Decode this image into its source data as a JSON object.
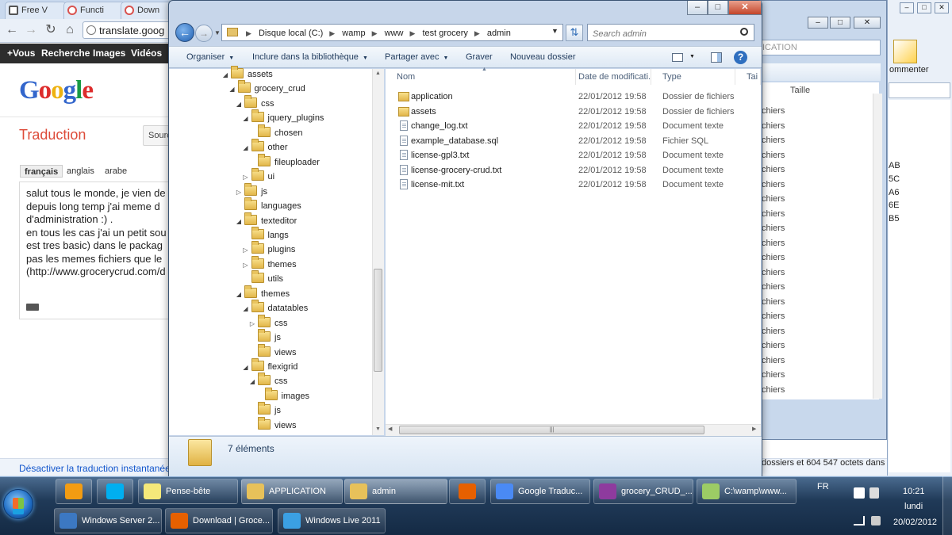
{
  "chrome": {
    "tabs": [
      "Free V",
      "Functi",
      "Down"
    ],
    "address": "translate.goog",
    "gbar": [
      "+Vous",
      "Recherche",
      "Images",
      "Vidéos"
    ],
    "logo": "Google",
    "title": "Traduction",
    "source_button": "Sourc",
    "lang_tabs": [
      "français",
      "anglais",
      "arabe"
    ],
    "source_lines": [
      "salut tous le monde, je vien de",
      "depuis long temp j'ai meme d",
      "d'administration :) .",
      "en tous les cas j'ai un petit sou",
      "est tres basic) dans le packag",
      "pas les memes fichiers que le",
      "(http://www.grocerycrud.com/d"
    ],
    "instant_link": "Désactiver la traduction instantanée"
  },
  "explorer2": {
    "header_size": "Taille",
    "search_hint": "ICATION",
    "row_label": "chiers",
    "row_value_top": "32",
    "status": "dossiers et 604 547 octets dans 5 fichiers"
  },
  "right_window": {
    "commenter": "ommenter",
    "hex_values": [
      "AB",
      "5C",
      "A6",
      "6E",
      "B5"
    ]
  },
  "explorer": {
    "title_buttons": {
      "minimize": "–",
      "maximize": "□",
      "close": "✕"
    },
    "breadcrumb": [
      "Disque local (C:)",
      "wamp",
      "www",
      "test grocery",
      "admin"
    ],
    "search_placeholder": "Search admin",
    "toolbar": {
      "organize": "Organiser",
      "include_library": "Inclure dans la bibliothèque",
      "share": "Partager avec",
      "burn": "Graver",
      "new_folder": "Nouveau dossier"
    },
    "tree": [
      {
        "label": "assets",
        "expanded": true
      },
      {
        "label": "grocery_crud",
        "expanded": true
      },
      {
        "label": "css",
        "expanded": true
      },
      {
        "label": "jquery_plugins",
        "expanded": true
      },
      {
        "label": "chosen",
        "expanded": null
      },
      {
        "label": "other",
        "expanded": true
      },
      {
        "label": "fileuploader",
        "expanded": null
      },
      {
        "label": "ui",
        "expanded": false
      },
      {
        "label": "js",
        "expanded": false
      },
      {
        "label": "languages",
        "expanded": null
      },
      {
        "label": "texteditor",
        "expanded": true
      },
      {
        "label": "langs",
        "expanded": null
      },
      {
        "label": "plugins",
        "expanded": false
      },
      {
        "label": "themes",
        "expanded": false
      },
      {
        "label": "utils",
        "expanded": null
      },
      {
        "label": "themes",
        "expanded": true
      },
      {
        "label": "datatables",
        "expanded": true
      },
      {
        "label": "css",
        "expanded": false
      },
      {
        "label": "js",
        "expanded": null
      },
      {
        "label": "views",
        "expanded": null
      },
      {
        "label": "flexigrid",
        "expanded": true
      },
      {
        "label": "css",
        "expanded": true
      },
      {
        "label": "images",
        "expanded": null
      },
      {
        "label": "js",
        "expanded": null
      },
      {
        "label": "views",
        "expanded": null
      }
    ],
    "columns": {
      "name": "Nom",
      "date": "Date de modificati...",
      "type": "Type",
      "size": "Tai"
    },
    "files": [
      {
        "name": "application",
        "date": "22/01/2012 19:58",
        "type": "Dossier de fichiers",
        "kind": "folder"
      },
      {
        "name": "assets",
        "date": "22/01/2012 19:58",
        "type": "Dossier de fichiers",
        "kind": "folder"
      },
      {
        "name": "change_log.txt",
        "date": "22/01/2012 19:58",
        "type": "Document texte",
        "kind": "file"
      },
      {
        "name": "example_database.sql",
        "date": "22/01/2012 19:58",
        "type": "Fichier SQL",
        "kind": "file"
      },
      {
        "name": "license-gpl3.txt",
        "date": "22/01/2012 19:58",
        "type": "Document texte",
        "kind": "file"
      },
      {
        "name": "license-grocery-crud.txt",
        "date": "22/01/2012 19:58",
        "type": "Document texte",
        "kind": "file"
      },
      {
        "name": "license-mit.txt",
        "date": "22/01/2012 19:58",
        "type": "Document texte",
        "kind": "file"
      }
    ],
    "item_count": "7 éléments"
  },
  "taskbar": {
    "row1": [
      {
        "label": "",
        "icon": "outlook-icon",
        "color": "#f39c12"
      },
      {
        "label": "",
        "icon": "skype-icon",
        "color": "#00aff0"
      },
      {
        "label": "Pense-bête",
        "icon": "sticky-notes-icon",
        "color": "#f5e97a"
      },
      {
        "label": "APPLICATION",
        "icon": "folder-icon",
        "color": "#e7c15a"
      },
      {
        "label": "admin",
        "icon": "folder-icon",
        "color": "#e7c15a"
      },
      {
        "label": "",
        "icon": "firefox-icon",
        "color": "#e66000"
      },
      {
        "label": "Google Traduc...",
        "icon": "chrome-icon",
        "color": "#4a8af4"
      },
      {
        "label": "grocery_CRUD_...",
        "icon": "winrar-icon",
        "color": "#8e3b9e"
      },
      {
        "label": "C:\\wamp\\www...",
        "icon": "notepad-icon",
        "color": "#9ccc65"
      }
    ],
    "row2": [
      {
        "label": "Windows Server 2...",
        "icon": "virtualbox-icon",
        "color": "#3c78c2"
      },
      {
        "label": "Download | Groce...",
        "icon": "firefox-icon",
        "color": "#e66000"
      },
      {
        "label": "Windows Live 2011",
        "icon": "windows-live-icon",
        "color": "#3ba0e4"
      }
    ],
    "language": "FR",
    "time": "10:21",
    "day": "lundi",
    "date": "20/02/2012"
  }
}
